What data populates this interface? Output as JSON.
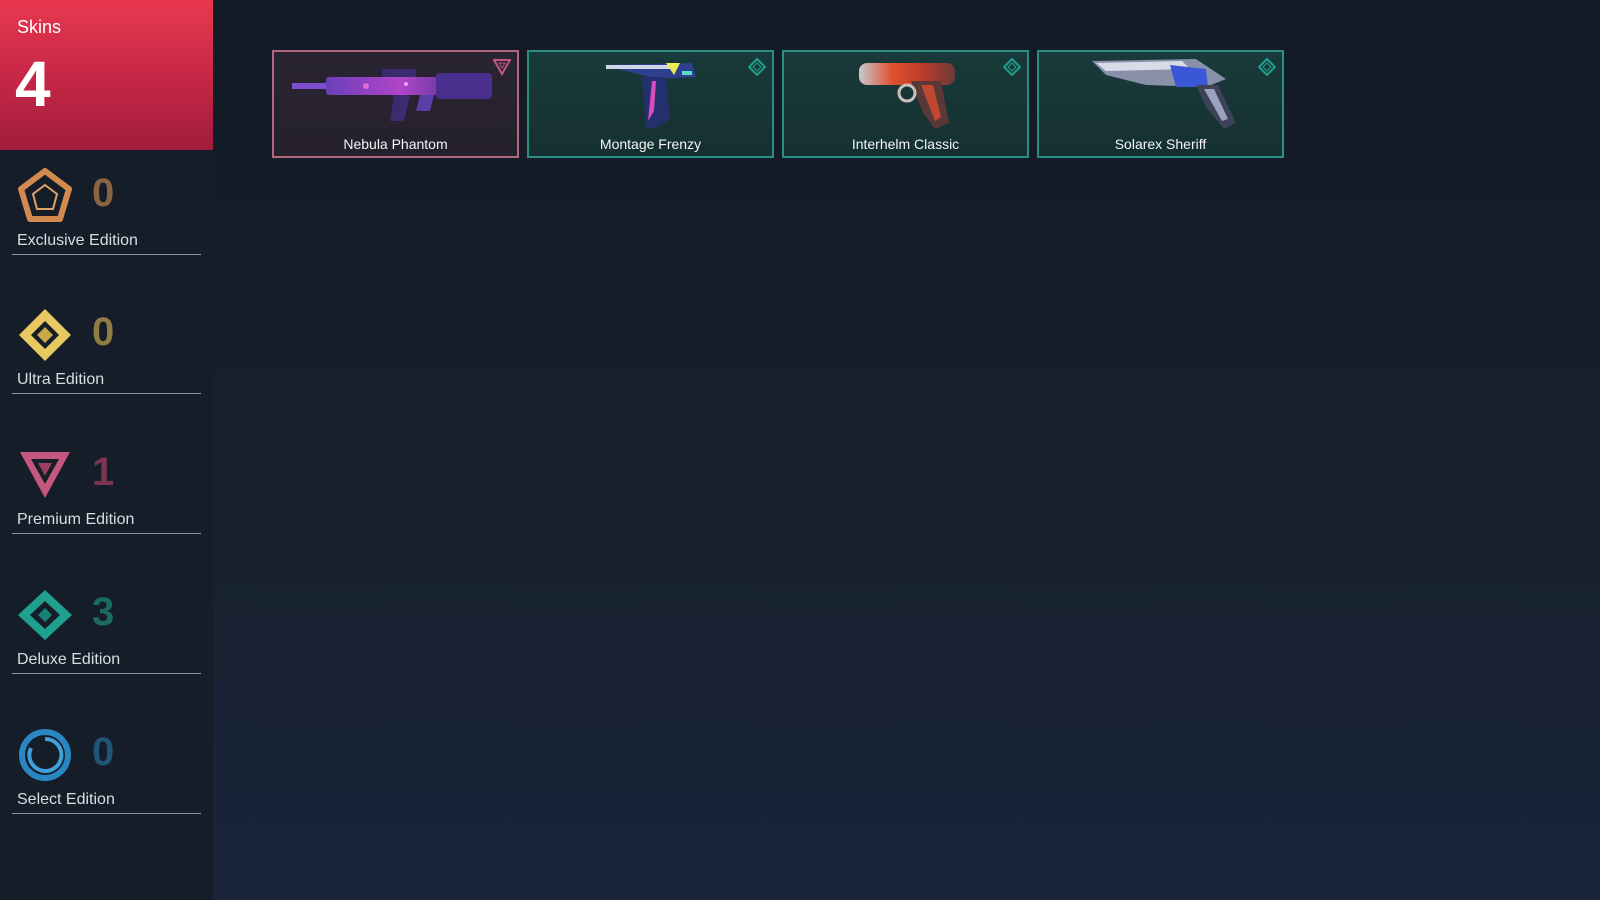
{
  "summary": {
    "label": "Skins",
    "total": "4"
  },
  "tiers": [
    {
      "name": "Exclusive Edition",
      "count": "0",
      "color": "#d38a50",
      "icon": "exclusive-pentagon-icon"
    },
    {
      "name": "Ultra Edition",
      "count": "0",
      "color": "#e8c861",
      "icon": "ultra-diamond-icon"
    },
    {
      "name": "Premium Edition",
      "count": "1",
      "color": "#c5577f",
      "icon": "premium-triangle-icon"
    },
    {
      "name": "Deluxe Edition",
      "count": "3",
      "color": "#1fa08f",
      "icon": "deluxe-diamond-icon"
    },
    {
      "name": "Select Edition",
      "count": "0",
      "color": "#2a86c2",
      "icon": "select-circle-icon"
    }
  ],
  "skins": [
    {
      "name": "Nebula Phantom",
      "tier": "Premium Edition",
      "icon": "phantom-rifle-icon"
    },
    {
      "name": "Montage Frenzy",
      "tier": "Deluxe Edition",
      "icon": "frenzy-pistol-icon"
    },
    {
      "name": "Interhelm Classic",
      "tier": "Deluxe Edition",
      "icon": "classic-pistol-icon"
    },
    {
      "name": "Solarex Sheriff",
      "tier": "Deluxe Edition",
      "icon": "sheriff-revolver-icon"
    }
  ],
  "colors": {
    "accent": "#e8384f",
    "deluxe_border": "#2a8f82",
    "premium_border": "#b2677f",
    "count_exclusive": "#8a6244",
    "count_ultra": "#8f7d44",
    "count_premium": "#7a3651",
    "count_deluxe": "#1b6a62",
    "count_select": "#1f5579"
  }
}
